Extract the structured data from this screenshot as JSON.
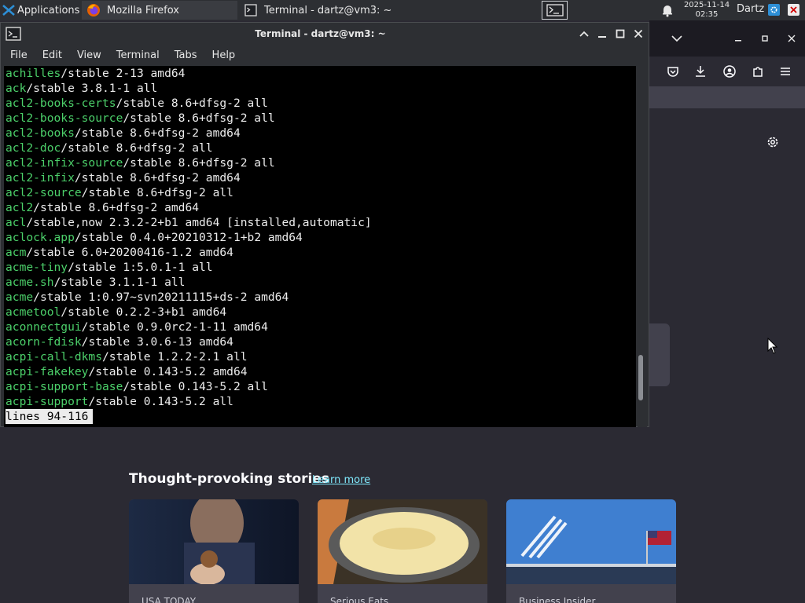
{
  "panel": {
    "applications_label": "Applications",
    "tasks": [
      {
        "label": "Mozilla Firefox",
        "icon": "firefox-icon"
      },
      {
        "label": "Terminal - dartz@vm3: ~",
        "icon": "terminal-icon"
      }
    ],
    "clock_date": "2025-11-14",
    "clock_time": "02:35",
    "user": "Dartz"
  },
  "terminal": {
    "title": "Terminal - dartz@vm3: ~",
    "menu": [
      "File",
      "Edit",
      "View",
      "Terminal",
      "Tabs",
      "Help"
    ],
    "lines": [
      {
        "pkg": "achilles",
        "rest": "/stable 2-13 amd64"
      },
      {
        "pkg": "ack",
        "rest": "/stable 3.8.1-1 all"
      },
      {
        "pkg": "acl2-books-certs",
        "rest": "/stable 8.6+dfsg-2 all"
      },
      {
        "pkg": "acl2-books-source",
        "rest": "/stable 8.6+dfsg-2 all"
      },
      {
        "pkg": "acl2-books",
        "rest": "/stable 8.6+dfsg-2 amd64"
      },
      {
        "pkg": "acl2-doc",
        "rest": "/stable 8.6+dfsg-2 all"
      },
      {
        "pkg": "acl2-infix-source",
        "rest": "/stable 8.6+dfsg-2 all"
      },
      {
        "pkg": "acl2-infix",
        "rest": "/stable 8.6+dfsg-2 amd64"
      },
      {
        "pkg": "acl2-source",
        "rest": "/stable 8.6+dfsg-2 all"
      },
      {
        "pkg": "acl2",
        "rest": "/stable 8.6+dfsg-2 amd64"
      },
      {
        "pkg": "acl",
        "rest": "/stable,now 2.3.2-2+b1 amd64 [installed,automatic]"
      },
      {
        "pkg": "aclock.app",
        "rest": "/stable 0.4.0+20210312-1+b2 amd64"
      },
      {
        "pkg": "acm",
        "rest": "/stable 6.0+20200416-1.2 amd64"
      },
      {
        "pkg": "acme-tiny",
        "rest": "/stable 1:5.0.1-1 all"
      },
      {
        "pkg": "acme.sh",
        "rest": "/stable 3.1.1-1 all"
      },
      {
        "pkg": "acme",
        "rest": "/stable 1:0.97~svn20211115+ds-2 amd64"
      },
      {
        "pkg": "acmetool",
        "rest": "/stable 0.2.2-3+b1 amd64"
      },
      {
        "pkg": "aconnectgui",
        "rest": "/stable 0.9.0rc2-1-11 amd64"
      },
      {
        "pkg": "acorn-fdisk",
        "rest": "/stable 3.0.6-13 amd64"
      },
      {
        "pkg": "acpi-call-dkms",
        "rest": "/stable 1.2.2-2.1 all"
      },
      {
        "pkg": "acpi-fakekey",
        "rest": "/stable 0.143-5.2 amd64"
      },
      {
        "pkg": "acpi-support-base",
        "rest": "/stable 0.143-5.2 all"
      },
      {
        "pkg": "acpi-support",
        "rest": "/stable 0.143-5.2 all"
      }
    ],
    "status": "lines 94-116"
  },
  "firefox": {
    "stories_title": "Thought-provoking stories",
    "stories_link": "Learn more",
    "cards": [
      {
        "source": "USA TODAY"
      },
      {
        "source": "Serious Eats"
      },
      {
        "source": "Business Insider"
      }
    ]
  },
  "colors": {
    "package_green": "#4cd06a",
    "terminal_bg": "#000000",
    "link_blue": "#80ebff"
  }
}
